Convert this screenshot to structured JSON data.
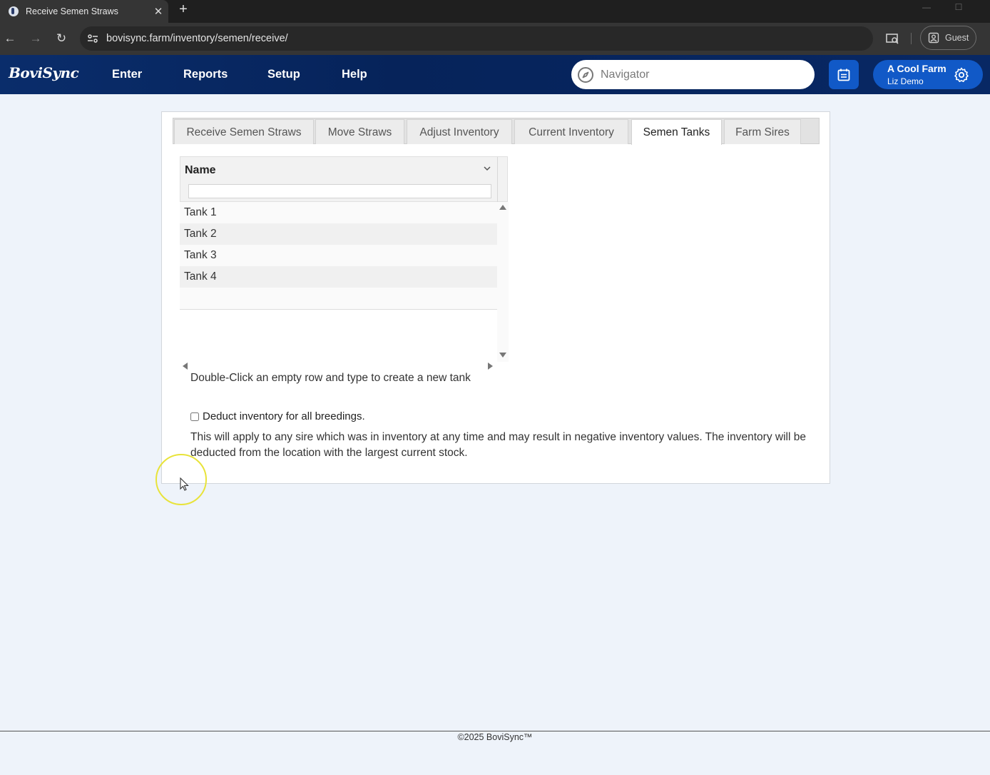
{
  "browser": {
    "tab_title": "Receive Semen Straws",
    "tab_close": "✕",
    "new_tab": "+",
    "url": "bovisync.farm/inventory/semen/receive/",
    "profile_label": "Guest"
  },
  "app": {
    "logo_text": "BoviSync",
    "menu": [
      {
        "label": "Enter"
      },
      {
        "label": "Reports"
      },
      {
        "label": "Setup"
      },
      {
        "label": "Help"
      }
    ],
    "navigator_placeholder": "Navigator",
    "farm_name": "A Cool Farm",
    "user_name": "Liz Demo",
    "accent_color": "#1159c7",
    "header_color": "#082864"
  },
  "tabs": [
    {
      "label": "Receive Semen Straws"
    },
    {
      "label": "Move Straws"
    },
    {
      "label": "Adjust Inventory"
    },
    {
      "label": "Current Inventory"
    },
    {
      "label": "Semen Tanks",
      "active": true
    },
    {
      "label": "Farm Sires"
    }
  ],
  "grid": {
    "column_header": "Name",
    "filter_value": "",
    "rows": [
      "Tank 1",
      "Tank 2",
      "Tank 3",
      "Tank 4"
    ]
  },
  "hint": "Double-Click an empty row and type to create a new tank",
  "deduct": {
    "label": "Deduct inventory for all breedings.",
    "checked": false,
    "description": "This will apply to any sire which was in inventory at any time and may result in negative inventory values. The inventory will be deducted from the location with the largest current stock."
  },
  "footer": "©2025 BoviSync™"
}
